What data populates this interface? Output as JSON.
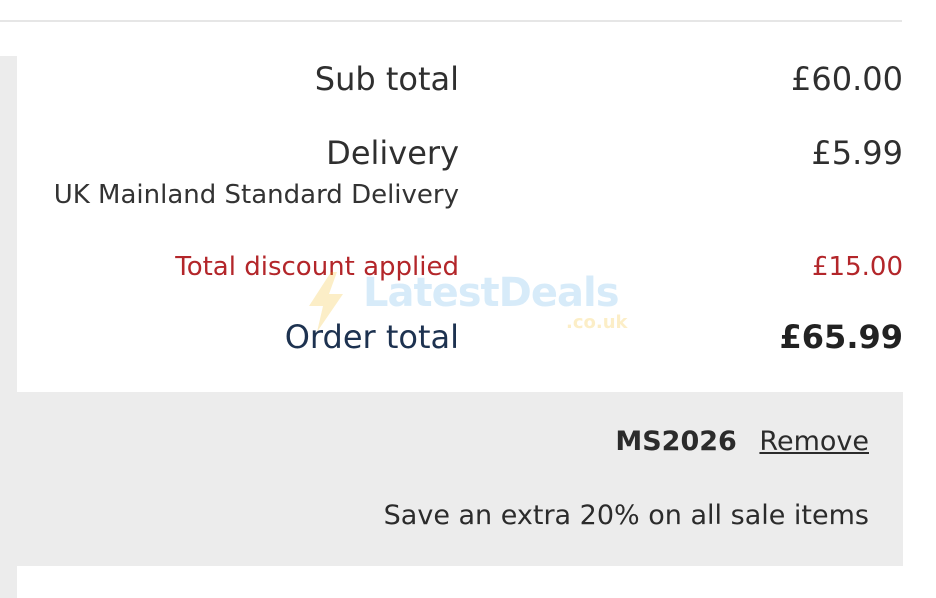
{
  "summary": {
    "subtotal_label": "Sub total",
    "subtotal_value": "£60.00",
    "delivery_label": "Delivery",
    "delivery_method": "UK Mainland Standard Delivery",
    "delivery_value": "£5.99",
    "discount_label": "Total discount applied",
    "discount_value": "£15.00",
    "order_total_label": "Order total",
    "order_total_value": "£65.99"
  },
  "promo": {
    "code": "MS2026",
    "remove_label": "Remove",
    "description": "Save an extra 20% on all sale items"
  },
  "watermark": {
    "text": "LatestDeals",
    "domain": ".co.uk"
  },
  "colors": {
    "discount": "#b3262a",
    "order_total_label": "#1d3250",
    "panel_gray": "#ececec"
  }
}
